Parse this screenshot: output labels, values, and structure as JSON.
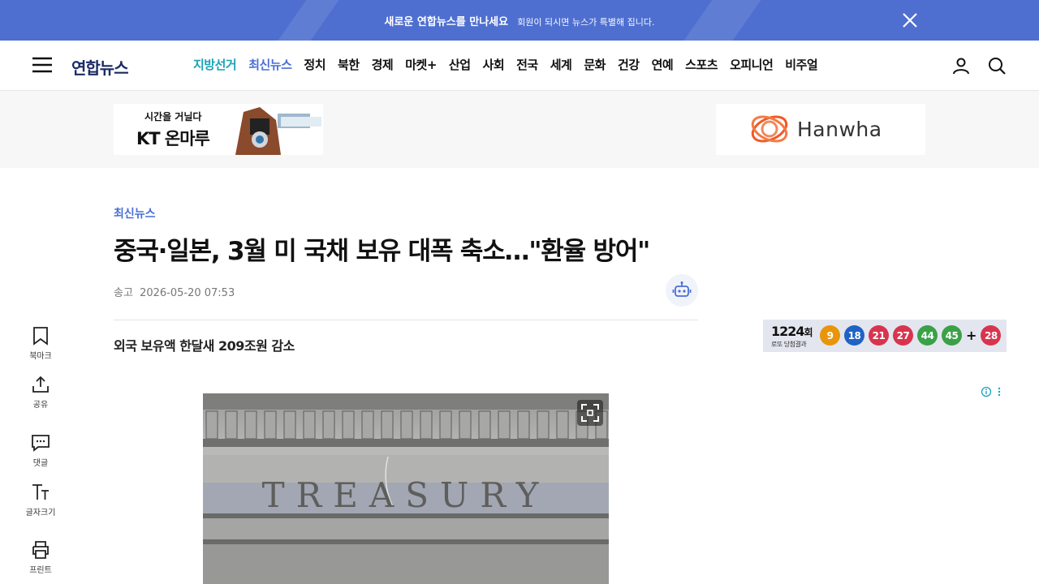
{
  "promo": {
    "main_text": "새로운 연합뉴스를 만나세요",
    "sub_text": "회원이 되시면 뉴스가 특별해 집니다.",
    "background": "#4f6fd0"
  },
  "header": {
    "logo": "연합뉴스",
    "nav": [
      {
        "label": "지방선거",
        "color": "#1aa3b8"
      },
      {
        "label": "최신뉴스",
        "color": "#4a6fd6"
      },
      {
        "label": "정치"
      },
      {
        "label": "북한"
      },
      {
        "label": "경제"
      },
      {
        "label": "마켓+"
      },
      {
        "label": "산업"
      },
      {
        "label": "사회"
      },
      {
        "label": "전국"
      },
      {
        "label": "세계"
      },
      {
        "label": "문화"
      },
      {
        "label": "건강"
      },
      {
        "label": "연예"
      },
      {
        "label": "스포츠"
      },
      {
        "label": "오피니언"
      },
      {
        "label": "비주얼"
      }
    ],
    "icons": [
      "user-icon",
      "search-icon"
    ]
  },
  "ads": {
    "kt": {
      "line1": "시간을 거닐다",
      "line2": "KT 온마루"
    },
    "hanwha": {
      "word": "Hanwha"
    }
  },
  "article": {
    "section": "최신뉴스",
    "headline": "중국·일본, 3월 미 국채 보유 대폭 축소…\"환율 방어\"",
    "meta_label": "송고",
    "date": "2026-05-20 07:53",
    "subheadline": "외국 보유액 한달새 209조원 감소",
    "photo_caption_text": "TREASURY"
  },
  "rail": {
    "bookmark": "북마크",
    "share": "공유",
    "comment": "댓글",
    "font_size": "글자크기",
    "print": "프린트"
  },
  "lotto": {
    "round": "1224",
    "round_suffix": "회",
    "caption": "로또 당첨결과",
    "numbers": [
      {
        "n": "9",
        "color": "#e8950c"
      },
      {
        "n": "18",
        "color": "#1f63c4"
      },
      {
        "n": "21",
        "color": "#d8344f"
      },
      {
        "n": "27",
        "color": "#d8344f"
      },
      {
        "n": "44",
        "color": "#3aa148"
      },
      {
        "n": "45",
        "color": "#3aa148"
      }
    ],
    "plus": "+",
    "bonus": {
      "n": "28",
      "color": "#d8344f"
    }
  },
  "colors": {
    "accent_blue": "#4a6fd6",
    "election_teal": "#1aa3b8",
    "logo_navy": "#1b2a66"
  }
}
